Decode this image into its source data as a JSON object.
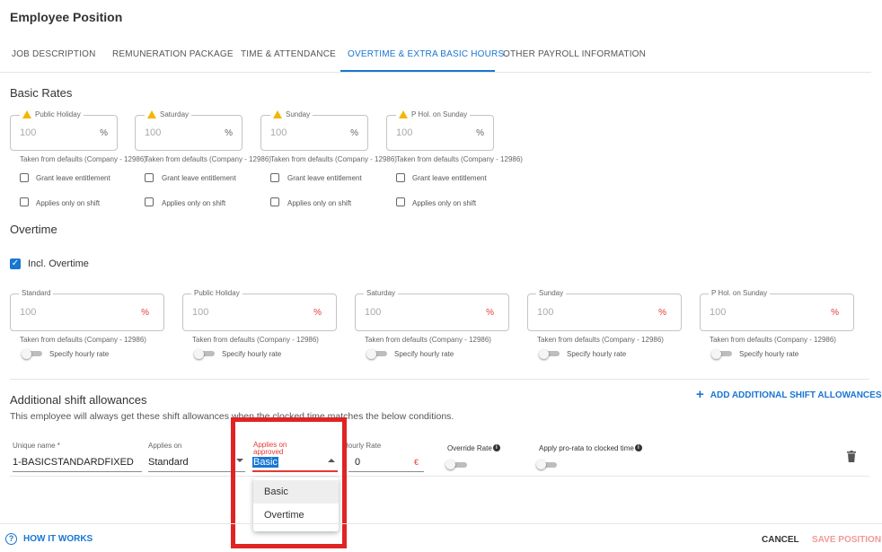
{
  "page": {
    "title": "Employee Position"
  },
  "tabs": [
    {
      "label": "JOB DESCRIPTION",
      "active": false
    },
    {
      "label": "REMUNERATION PACKAGE",
      "active": false
    },
    {
      "label": "TIME & ATTENDANCE",
      "active": false
    },
    {
      "label": "OVERTIME & EXTRA BASIC HOURS",
      "active": true
    },
    {
      "label": "OTHER PAYROLL INFORMATION",
      "active": false
    }
  ],
  "basic_rates": {
    "heading": "Basic Rates",
    "fields": [
      {
        "label": "Public Holiday",
        "value": "100",
        "suffix": "%",
        "helper": "Taken from defaults (Company - 12986)",
        "grant_label": "Grant leave entitlement",
        "shift_label": "Applies only on shift"
      },
      {
        "label": "Saturday",
        "value": "100",
        "suffix": "%",
        "helper": "Taken from defaults (Company - 12986)",
        "grant_label": "Grant leave entitlement",
        "shift_label": "Applies only on shift"
      },
      {
        "label": "Sunday",
        "value": "100",
        "suffix": "%",
        "helper": "Taken from defaults (Company - 12986)",
        "grant_label": "Grant leave entitlement",
        "shift_label": "Applies only on shift"
      },
      {
        "label": "P Hol. on Sunday",
        "value": "100",
        "suffix": "%",
        "helper": "Taken from defaults (Company - 12986)",
        "grant_label": "Grant leave entitlement",
        "shift_label": "Applies only on shift"
      }
    ]
  },
  "overtime": {
    "heading": "Overtime",
    "incl_label": "Incl. Overtime",
    "incl_checked": true,
    "fields": [
      {
        "label": "Standard",
        "value": "100",
        "suffix": "%",
        "helper": "Taken from defaults (Company - 12986)",
        "toggle_label": "Specify hourly rate"
      },
      {
        "label": "Public Holiday",
        "value": "100",
        "suffix": "%",
        "helper": "Taken from defaults (Company - 12986)",
        "toggle_label": "Specify hourly rate"
      },
      {
        "label": "Saturday",
        "value": "100",
        "suffix": "%",
        "helper": "Taken from defaults (Company - 12986)",
        "toggle_label": "Specify hourly rate"
      },
      {
        "label": "Sunday",
        "value": "100",
        "suffix": "%",
        "helper": "Taken from defaults (Company - 12986)",
        "toggle_label": "Specify hourly rate"
      },
      {
        "label": "P Hol. on Sunday",
        "value": "100",
        "suffix": "%",
        "helper": "Taken from defaults (Company - 12986)",
        "toggle_label": "Specify hourly rate"
      }
    ]
  },
  "shift_allowances": {
    "heading": "Additional shift allowances",
    "description": "This employee will always get these shift allowances when the clocked time matches the below conditions.",
    "add_label": "ADD ADDITIONAL SHIFT ALLOWANCES",
    "row": {
      "unique_name_label": "Unique name *",
      "unique_name_value": "1-BASICSTANDARDFIXED",
      "applies_on_label": "Applies on",
      "applies_on_value": "Standard",
      "applies_on_approved_label_1": "Applies on",
      "applies_on_approved_label_2": "approved",
      "applies_on_approved_value": "Basic",
      "hourly_rate_label": "Hourly Rate",
      "hourly_rate_value": "0",
      "hourly_rate_suffix": "€",
      "override_rate_label": "Override Rate",
      "pro_rata_label": "Apply pro-rata to clocked time"
    },
    "dropdown_options": [
      "Basic",
      "Overtime"
    ],
    "dropdown_highlighted": "Basic"
  },
  "footer": {
    "how_it_works": "HOW IT WORKS",
    "cancel": "CANCEL",
    "save": "SAVE POSITION"
  },
  "colors": {
    "accent": "#1976d2",
    "warning": "#f2b705",
    "danger": "#e53935",
    "annotation": "#e02424"
  },
  "icons": [
    "warning-icon",
    "checkbox-icon",
    "plus-icon",
    "dropdown-arrow-icon",
    "info-icon",
    "delete-icon",
    "help-icon"
  ]
}
